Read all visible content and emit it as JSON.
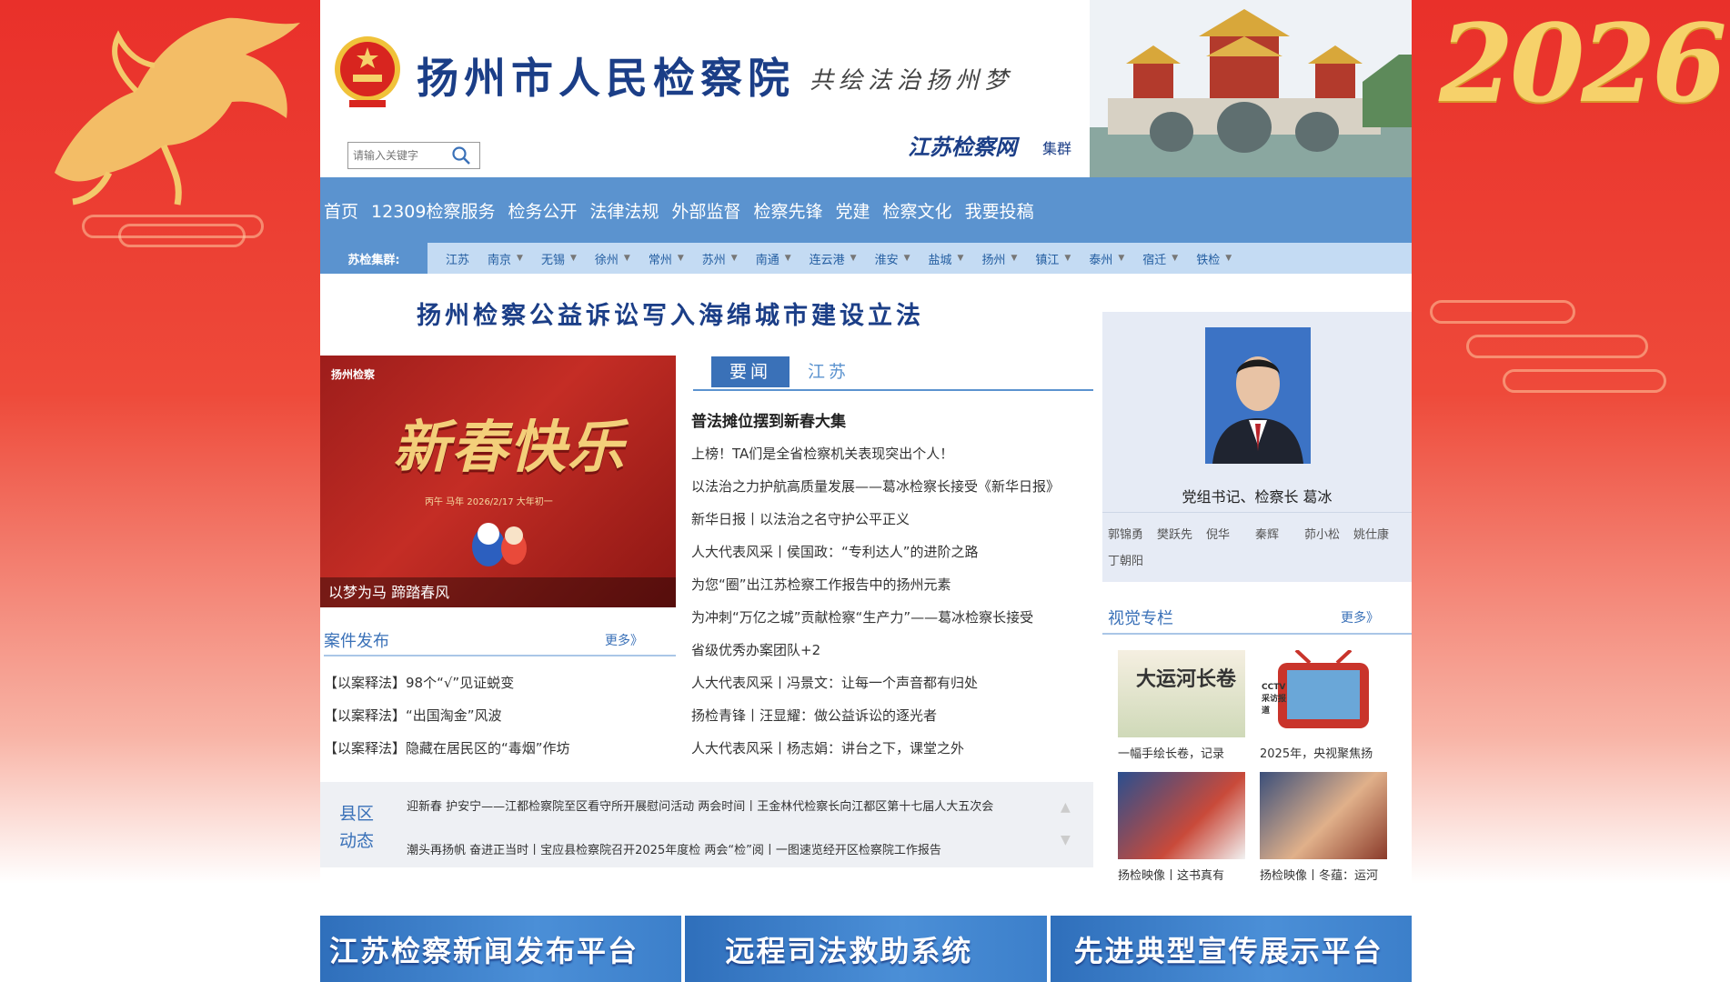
{
  "theme": {
    "primary": "#5b93cf",
    "title_blue": "#1b3e87",
    "accent_gold": "#f6d16a",
    "bg_red": "#e9302a"
  },
  "decor": {
    "year": "2026"
  },
  "header": {
    "site_title": "扬州市人民检察院",
    "slogan": "共绘法治扬州梦",
    "portal_name": "江苏检察网",
    "portal_suffix": "集群",
    "search_placeholder": "请输入关键字"
  },
  "nav": [
    "首页",
    "12309检察服务",
    "检务公开",
    "法律法规",
    "外部监督",
    "检察先锋",
    "党建",
    "检察文化",
    "我要投稿"
  ],
  "subnav": {
    "label": "苏检集群:",
    "items": [
      {
        "label": "江苏",
        "dropdown": false
      },
      {
        "label": "南京",
        "dropdown": true
      },
      {
        "label": "无锡",
        "dropdown": true
      },
      {
        "label": "徐州",
        "dropdown": true
      },
      {
        "label": "常州",
        "dropdown": true
      },
      {
        "label": "苏州",
        "dropdown": true
      },
      {
        "label": "南通",
        "dropdown": true
      },
      {
        "label": "连云港",
        "dropdown": true
      },
      {
        "label": "淮安",
        "dropdown": true
      },
      {
        "label": "盐城",
        "dropdown": true
      },
      {
        "label": "扬州",
        "dropdown": true
      },
      {
        "label": "镇江",
        "dropdown": true
      },
      {
        "label": "泰州",
        "dropdown": true
      },
      {
        "label": "宿迁",
        "dropdown": true
      },
      {
        "label": "铁检",
        "dropdown": true
      }
    ]
  },
  "headline": "扬州检察公益诉讼写入海绵城市建设立法",
  "slide": {
    "logo": "扬州检察",
    "art_text": "新春快乐",
    "date_text": "丙午 马年  2026/2/17  大年初一",
    "caption": "以梦为马 蹄踏春风"
  },
  "cases": {
    "title": "案件发布",
    "more": "更多》",
    "items": [
      "【以案释法】98个“√”见证蜕变",
      "【以案释法】“出国淘金”风波",
      "【以案释法】隐藏在居民区的“毒烟”作坊"
    ]
  },
  "news": {
    "tabs": [
      "要闻",
      "江苏"
    ],
    "lead": "普法摊位摆到新春大集",
    "items": [
      "上榜！TA们是全省检察机关表现突出个人！",
      "以法治之力护航高质量发展——葛冰检察长接受《新华日报》",
      "新华日报丨以法治之名守护公平正义",
      "人大代表风采丨侯国政：“专利达人”的进阶之路",
      "为您“圈”出江苏检察工作报告中的扬州元素",
      "为冲刺“万亿之城”贡献检察“生产力”——葛冰检察长接受",
      "省级优秀办案团队+2",
      "人大代表风采丨冯景文：让每一个声音都有归处",
      "扬检青锋丨汪显耀：做公益诉讼的逐光者",
      "人大代表风采丨杨志娟：讲台之下，课堂之外"
    ]
  },
  "leader": {
    "title": "党组书记、检察长 葛冰",
    "deputies": [
      "郭锦勇",
      "樊跃先",
      "倪华",
      "秦辉",
      "茆小松",
      "姚仕康",
      "丁朝阳"
    ]
  },
  "visual": {
    "title": "视觉专栏",
    "more": "更多》",
    "items": [
      {
        "caption": "一幅手绘长卷，记录",
        "art": "大运河长卷"
      },
      {
        "caption": "2025年，央视聚焦扬",
        "art": "CCTV 采访报道"
      },
      {
        "caption": "扬检映像丨这书真有",
        "art": ""
      },
      {
        "caption": "扬检映像丨冬蕴：运河",
        "art": ""
      }
    ]
  },
  "county": {
    "label": "县区动态",
    "rows": [
      "迎新春 护安宁——江都检察院至区看守所开展慰问活动    两会时间丨王金林代检察长向江都区第十七届人大五次会",
      "潮头再扬帆 奋进正当时丨宝应县检察院召开2025年度检    两会“检”阅丨一图速览经开区检察院工作报告"
    ]
  },
  "banners": [
    "江苏检察新闻发布平台",
    "远程司法救助系统",
    "先进典型宣传展示平台"
  ]
}
